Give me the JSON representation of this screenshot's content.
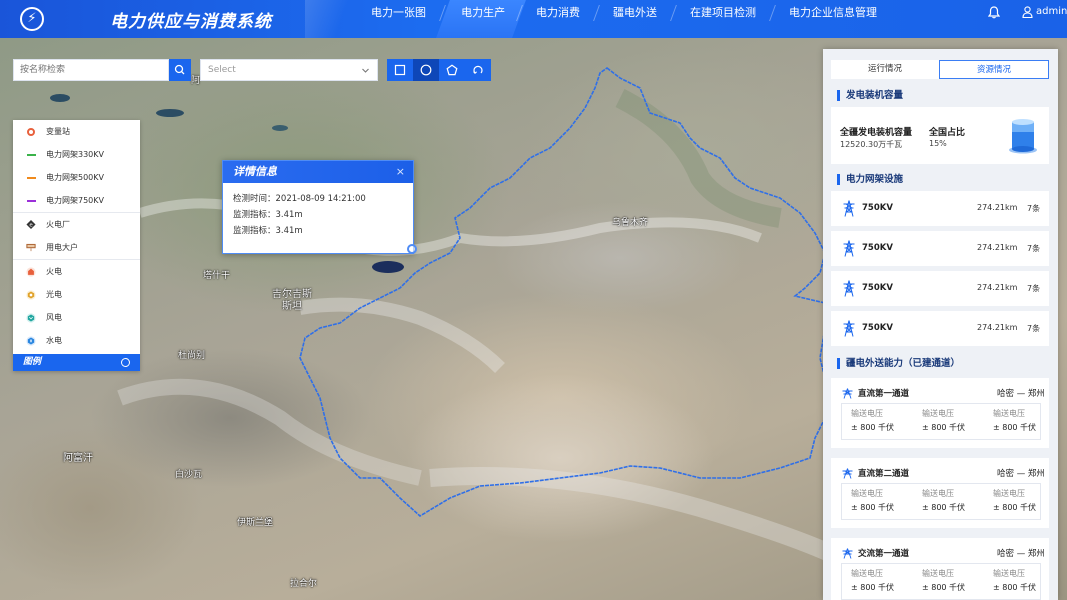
{
  "header": {
    "title": "电力供应与消费系统",
    "nav": [
      "电力一张图",
      "电力生产",
      "电力消费",
      "疆电外送",
      "在建项目检测",
      "电力企业信息管理"
    ],
    "active_nav": "电力生产",
    "user": "admin"
  },
  "search": {
    "placeholder": "按名称检索",
    "select_placeholder": "Select"
  },
  "legend": {
    "items": [
      {
        "label": "变量站",
        "icon": "substation-icon",
        "color": "#e8603c"
      },
      {
        "label": "电力网架330KV",
        "icon": "line-330kv",
        "color": "#3bb34a"
      },
      {
        "label": "电力网架500KV",
        "icon": "line-500kv",
        "color": "#f08a1c"
      },
      {
        "label": "电力网架750KV",
        "icon": "line-750kv",
        "color": "#9b30d9"
      },
      {
        "label": "火电厂",
        "icon": "thermal-plant-icon",
        "color": "#333333"
      },
      {
        "label": "用电大户",
        "icon": "big-consumer-icon",
        "color": "#b06a3a"
      },
      {
        "label": "火电",
        "icon": "fire-power-icon",
        "color": "#e8603c"
      },
      {
        "label": "光电",
        "icon": "solar-power-icon",
        "color": "#e0a22a"
      },
      {
        "label": "风电",
        "icon": "wind-power-icon",
        "color": "#21a6a0"
      },
      {
        "label": "水电",
        "icon": "hydro-power-icon",
        "color": "#2a86e0"
      }
    ],
    "footer": "图例"
  },
  "popup": {
    "title": "详情信息",
    "close": "×",
    "rows": [
      "检测时间：2021-08-09 14:21:00",
      "监测指标：3.41m",
      "监测指标：3.41m"
    ]
  },
  "map_labels": {
    "urumqi": "乌鲁木齐",
    "kyrgyzstan_1": "吉尔吉斯",
    "kyrgyzstan_2": "斯坦",
    "afghanistan": "阿富汗",
    "tashkent": "塔什干",
    "dushanbe": "杜尚别",
    "peshawar": "白沙瓦",
    "islamabad": "伊斯兰堡",
    "lahore": "拉合尔",
    "map_char": "阿"
  },
  "panel": {
    "tabs": [
      "运行情况",
      "资源情况"
    ],
    "active_tab": "资源情况",
    "capacity": {
      "section": "发电装机容量",
      "total_label": "全疆发电装机容量",
      "total_value": "12520.30万千瓦",
      "share_label": "全国占比",
      "share_value": "15%"
    },
    "grid": {
      "section": "电力网架设施",
      "rows": [
        {
          "kv": "750KV",
          "length": "274.21km",
          "count": "7条"
        },
        {
          "kv": "750KV",
          "length": "274.21km",
          "count": "7条"
        },
        {
          "kv": "750KV",
          "length": "274.21km",
          "count": "7条"
        },
        {
          "kv": "750KV",
          "length": "274.21km",
          "count": "7条"
        }
      ]
    },
    "transmission": {
      "section": "疆电外送能力（已建通道）",
      "channels": [
        {
          "name": "直流第一通道",
          "route": "哈密 — 郑州",
          "cols": [
            {
              "label": "输送电压",
              "value": "± 800 千伏"
            },
            {
              "label": "输送电压",
              "value": "± 800 千伏"
            },
            {
              "label": "输送电压",
              "value": "± 800 千伏"
            }
          ]
        },
        {
          "name": "直流第二通道",
          "route": "哈密 — 郑州",
          "cols": [
            {
              "label": "输送电压",
              "value": "± 800 千伏"
            },
            {
              "label": "输送电压",
              "value": "± 800 千伏"
            },
            {
              "label": "输送电压",
              "value": "± 800 千伏"
            }
          ]
        },
        {
          "name": "交流第一通道",
          "route": "哈密 — 郑州",
          "cols": [
            {
              "label": "输送电压",
              "value": "± 800 千伏"
            },
            {
              "label": "输送电压",
              "value": "± 800 千伏"
            },
            {
              "label": "输送电压",
              "value": "± 800 千伏"
            }
          ]
        }
      ]
    }
  },
  "colors": {
    "primary": "#1a66ee",
    "header": "#1c6cf0",
    "border_line": "#2f6fe8"
  }
}
